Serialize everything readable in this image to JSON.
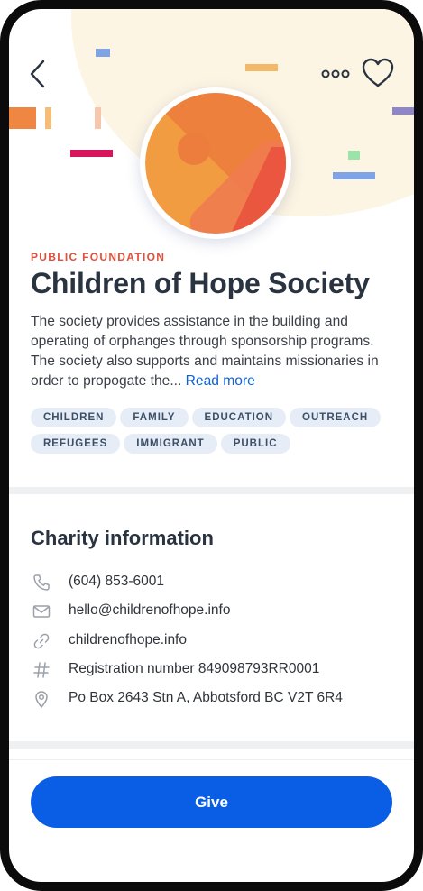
{
  "header": {
    "back_icon": "chevron-left-icon",
    "more_icon": "more-horizontal-icon",
    "favorite_icon": "heart-icon"
  },
  "organization": {
    "type": "PUBLIC FOUNDATION",
    "name": "Children of Hope Society",
    "description": "The society provides assistance in the building and operating of orphanges through sponsorship programs. The society also supports and maintains missionaries in order to propogate the...",
    "read_more": "Read more",
    "tags": [
      "CHILDREN",
      "FAMILY",
      "EDUCATION",
      "OUTREACH",
      "REFUGEES",
      "IMMIGRANT",
      "PUBLIC"
    ]
  },
  "charity_info": {
    "title": "Charity information",
    "phone": "(604) 853-6001",
    "email": "hello@childrenofhope.info",
    "website": "childrenofhope.info",
    "registration": "Registration number 849098793RR0001",
    "address": "Po Box 2643 Stn A, Abbotsford BC  V2T 6R4"
  },
  "actions": {
    "give_label": "Give"
  },
  "colors": {
    "accent": "#0a5ee6",
    "label_red": "#e0503a",
    "logo_orange": "#f29c42",
    "logo_red": "#e94e3c"
  }
}
